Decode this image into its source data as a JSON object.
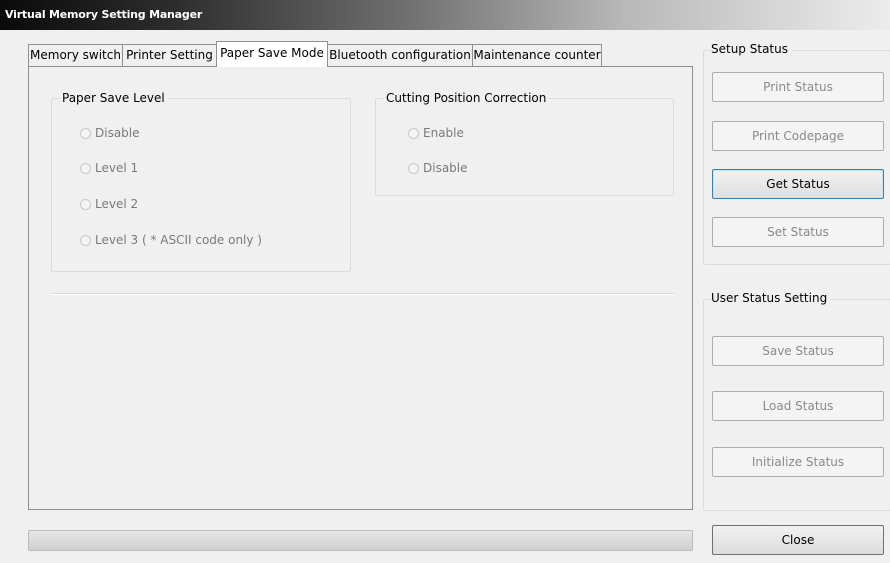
{
  "window": {
    "title": "Virtual Memory Setting Manager"
  },
  "tabs": [
    {
      "label": "Memory switch",
      "active": false
    },
    {
      "label": "Printer Setting",
      "active": false
    },
    {
      "label": "Paper Save Mode",
      "active": true
    },
    {
      "label": "Bluetooth configuration",
      "active": false
    },
    {
      "label": "Maintenance counter",
      "active": false
    }
  ],
  "paper_save_level": {
    "title": "Paper Save Level",
    "options": [
      "Disable",
      "Level 1",
      "Level 2",
      "Level 3 ( * ASCII code only )"
    ],
    "enabled": false
  },
  "cutting_position": {
    "title": "Cutting Position Correction",
    "options": [
      "Enable",
      "Disable"
    ],
    "enabled": false
  },
  "setup_status": {
    "title": "Setup Status",
    "print_status": "Print Status",
    "print_codepage": "Print Codepage",
    "get_status": "Get Status",
    "set_status": "Set Status"
  },
  "user_status": {
    "title": "User Status Setting",
    "save_status": "Save Status",
    "load_status": "Load Status",
    "initialize_status": "Initialize Status"
  },
  "close_label": "Close",
  "progress": 0
}
